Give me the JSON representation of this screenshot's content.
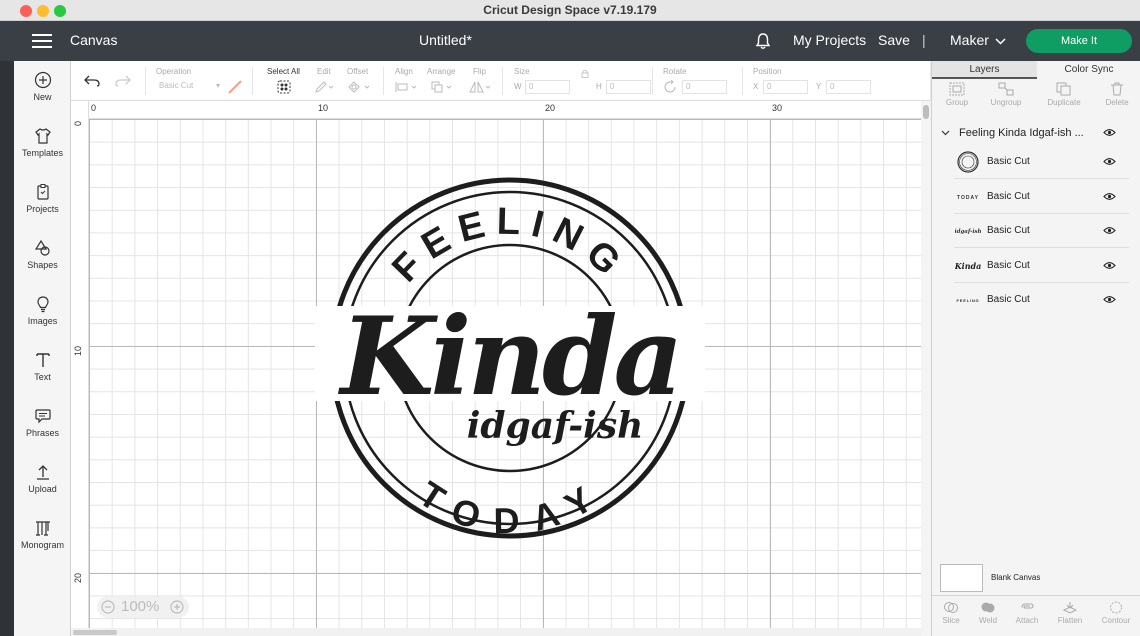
{
  "window": {
    "title": "Cricut Design Space  v7.19.179"
  },
  "header": {
    "section": "Canvas",
    "doc_title": "Untitled*",
    "my_projects": "My Projects",
    "save": "Save",
    "separator": "|",
    "machine": "Maker",
    "make_it": "Make It"
  },
  "sidebar": {
    "items": [
      {
        "label": "New",
        "icon": "plus-circle-icon"
      },
      {
        "label": "Templates",
        "icon": "shirt-icon"
      },
      {
        "label": "Projects",
        "icon": "clipboard-icon"
      },
      {
        "label": "Shapes",
        "icon": "shapes-icon"
      },
      {
        "label": "Images",
        "icon": "lightbulb-icon"
      },
      {
        "label": "Text",
        "icon": "text-t-icon"
      },
      {
        "label": "Phrases",
        "icon": "speech-bubble-icon"
      },
      {
        "label": "Upload",
        "icon": "upload-arrow-icon"
      },
      {
        "label": "Monogram",
        "icon": "monogram-icon"
      }
    ]
  },
  "toolbar": {
    "operation_label": "Operation",
    "operation_value": "Basic Cut",
    "select_all": "Select All",
    "edit": "Edit",
    "offset": "Offset",
    "align": "Align",
    "arrange": "Arrange",
    "flip": "Flip",
    "size": "Size",
    "w_label": "W",
    "w_value": "0",
    "h_label": "H",
    "h_value": "0",
    "rotate": "Rotate",
    "rotate_value": "0",
    "position": "Position",
    "x_label": "X",
    "x_value": "0",
    "y_label": "Y",
    "y_value": "0"
  },
  "canvas": {
    "ruler_top": [
      "0",
      "10",
      "20",
      "30"
    ],
    "ruler_left": [
      "0",
      "10",
      "20"
    ],
    "zoom": "100%",
    "design": {
      "top_arc": "FEELING",
      "main": "Kinda",
      "sub": "idgaf-ish",
      "bottom_arc": "TODAY"
    }
  },
  "right_panel": {
    "tabs": [
      "Layers",
      "Color Sync"
    ],
    "tools": [
      "Group",
      "Ungroup",
      "Duplicate",
      "Delete"
    ],
    "group_name": "Feeling Kinda Idgaf-ish ...",
    "layers": [
      {
        "name": "Basic Cut",
        "thumb": "rings"
      },
      {
        "name": "Basic Cut",
        "thumb": "TODAY"
      },
      {
        "name": "Basic Cut",
        "thumb": "idgaf-ish"
      },
      {
        "name": "Basic Cut",
        "thumb": "Kinda"
      },
      {
        "name": "Basic Cut",
        "thumb": "FEELING"
      }
    ],
    "blank_canvas": "Blank Canvas",
    "bottom_tools": [
      "Slice",
      "Weld",
      "Attach",
      "Flatten",
      "Contour"
    ]
  }
}
